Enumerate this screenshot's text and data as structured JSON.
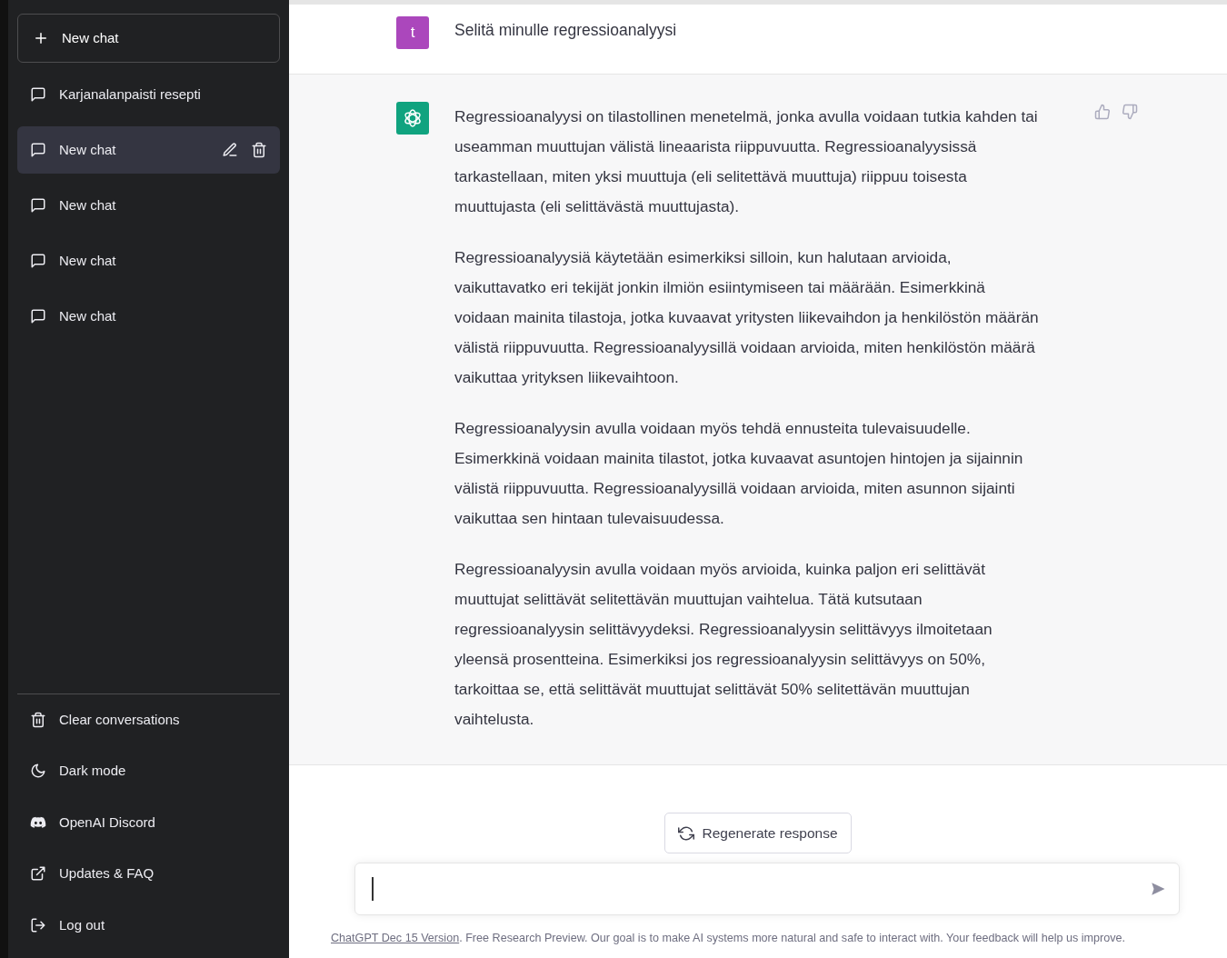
{
  "sidebar": {
    "new_chat_button": "New chat",
    "chats": [
      {
        "title": "Karjanalanpaisti resepti",
        "selected": false
      },
      {
        "title": "New chat",
        "selected": true
      },
      {
        "title": "New chat",
        "selected": false
      },
      {
        "title": "New chat",
        "selected": false
      },
      {
        "title": "New chat",
        "selected": false
      }
    ],
    "menu": [
      {
        "label": "Clear conversations"
      },
      {
        "label": "Dark mode"
      },
      {
        "label": "OpenAI Discord"
      },
      {
        "label": "Updates & FAQ"
      },
      {
        "label": "Log out"
      }
    ]
  },
  "conversation": {
    "user_message": {
      "avatar": "t",
      "text": "Selitä minulle regressioanalyysi"
    },
    "assistant_message": {
      "paragraphs": [
        "Regressioanalyysi on tilastollinen menetelmä, jonka avulla voidaan tutkia kahden tai useamman muuttujan välistä lineaarista riippuvuutta. Regressioanalyysissä tarkastellaan, miten yksi muuttuja (eli selitettävä muuttuja) riippuu toisesta muuttujasta (eli selittävästä muuttujasta).",
        "Regressioanalyysiä käytetään esimerkiksi silloin, kun halutaan arvioida, vaikuttavatko eri tekijät jonkin ilmiön esiintymiseen tai määrään. Esimerkkinä voidaan mainita tilastoja, jotka kuvaavat yritysten liikevaihdon ja henkilöstön määrän välistä riippuvuutta. Regressioanalyysillä voidaan arvioida, miten henkilöstön määrä vaikuttaa yrityksen liikevaihtoon.",
        "Regressioanalyysin avulla voidaan myös tehdä ennusteita tulevaisuudelle. Esimerkkinä voidaan mainita tilastot, jotka kuvaavat asuntojen hintojen ja sijainnin välistä riippuvuutta. Regressioanalyysillä voidaan arvioida, miten asunnon sijainti vaikuttaa sen hintaan tulevaisuudessa.",
        "Regressioanalyysin avulla voidaan myös arvioida, kuinka paljon eri selittävät muuttujat selittävät selitettävän muuttujan vaihtelua. Tätä kutsutaan regressioanalyysin selittävyydeksi. Regressioanalyysin selittävyys ilmoitetaan yleensä prosentteina. Esimerkiksi jos regressioanalyysin selittävyys on 50%, tarkoittaa se, että selittävät muuttujat selittävät 50% selitettävän muuttujan vaihtelusta."
      ]
    }
  },
  "regenerate_button": "Regenerate response",
  "footer": {
    "link": "ChatGPT Dec 15 Version",
    "text": ". Free Research Preview. Our goal is to make AI systems more natural and safe to interact with. Your feedback will help us improve."
  }
}
